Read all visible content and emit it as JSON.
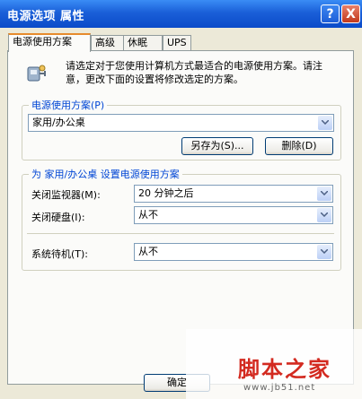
{
  "window": {
    "title": "电源选项 属性",
    "help_label": "?",
    "close_label": "X"
  },
  "tabs": [
    {
      "label": "电源使用方案",
      "active": true
    },
    {
      "label": "高级",
      "active": false
    },
    {
      "label": "休眠",
      "active": false
    },
    {
      "label": "UPS",
      "active": false
    }
  ],
  "description": "请选定对于您使用计算机方式最适合的电源使用方案。请注意，更改下面的设置将修改选定的方案。",
  "scheme_group": {
    "title": "电源使用方案(P)",
    "selected": "家用/办公桌",
    "save_as_label": "另存为(S)...",
    "delete_label": "删除(D)"
  },
  "settings_group": {
    "title": "为 家用/办公桌 设置电源使用方案",
    "monitor_label": "关闭监视器(M):",
    "monitor_value": "20 分钟之后",
    "harddisk_label": "关闭硬盘(I):",
    "harddisk_value": "从不",
    "standby_label": "系统待机(T):",
    "standby_value": "从不"
  },
  "footer": {
    "ok_label": "确定"
  },
  "watermark": {
    "brand": "脚本之家",
    "url": "www.jb51.net"
  },
  "colors": {
    "accent": "#e68b2c",
    "titlebar": "#0b4bc9",
    "group_title": "#0046d5",
    "watermark": "#d32a20"
  }
}
